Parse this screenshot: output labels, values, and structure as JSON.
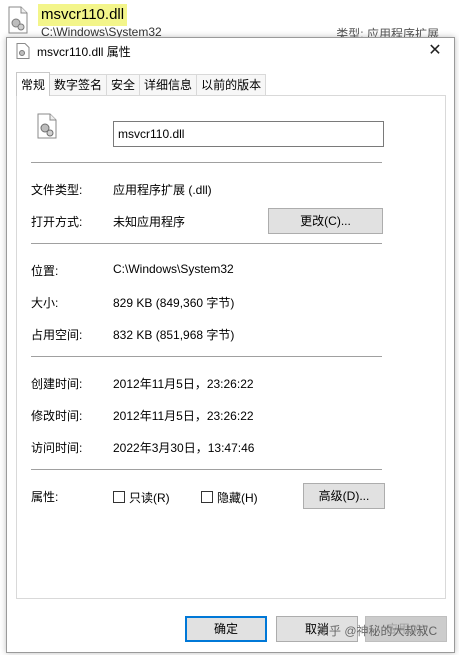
{
  "explorer": {
    "filename": "msvcr110.dll",
    "path": "C:\\Windows\\System32",
    "type_label": "类型:",
    "type_value": "应用程序扩展"
  },
  "dialog": {
    "title": "msvcr110.dll 属性",
    "close_glyph": "✕",
    "tabs": [
      "常规",
      "数字签名",
      "安全",
      "详细信息",
      "以前的版本"
    ],
    "filename_value": "msvcr110.dll",
    "file_type_label": "文件类型:",
    "file_type_value": "应用程序扩展 (.dll)",
    "opens_with_label": "打开方式:",
    "opens_with_value": "未知应用程序",
    "change_button": "更改(C)...",
    "location_label": "位置:",
    "location_value": "C:\\Windows\\System32",
    "size_label": "大小:",
    "size_value": "829 KB (849,360 字节)",
    "size_on_disk_label": "占用空间:",
    "size_on_disk_value": "832 KB (851,968 字节)",
    "created_label": "创建时间:",
    "created_value": "2012年11月5日，23:26:22",
    "modified_label": "修改时间:",
    "modified_value": "2012年11月5日，23:26:22",
    "accessed_label": "访问时间:",
    "accessed_value": "2022年3月30日，13:47:46",
    "attributes_label": "属性:",
    "readonly_label": "只读(R)",
    "hidden_label": "隐藏(H)",
    "advanced_button": "高级(D)...",
    "ok_button": "确定",
    "cancel_button": "取消",
    "apply_button": "应用(A)"
  },
  "watermark": "知乎 @神秘的大叔叔C",
  "colors": {
    "highlight": "#f3f58a",
    "focus_border": "#0078d7",
    "button_bg": "#e1e1e1"
  }
}
